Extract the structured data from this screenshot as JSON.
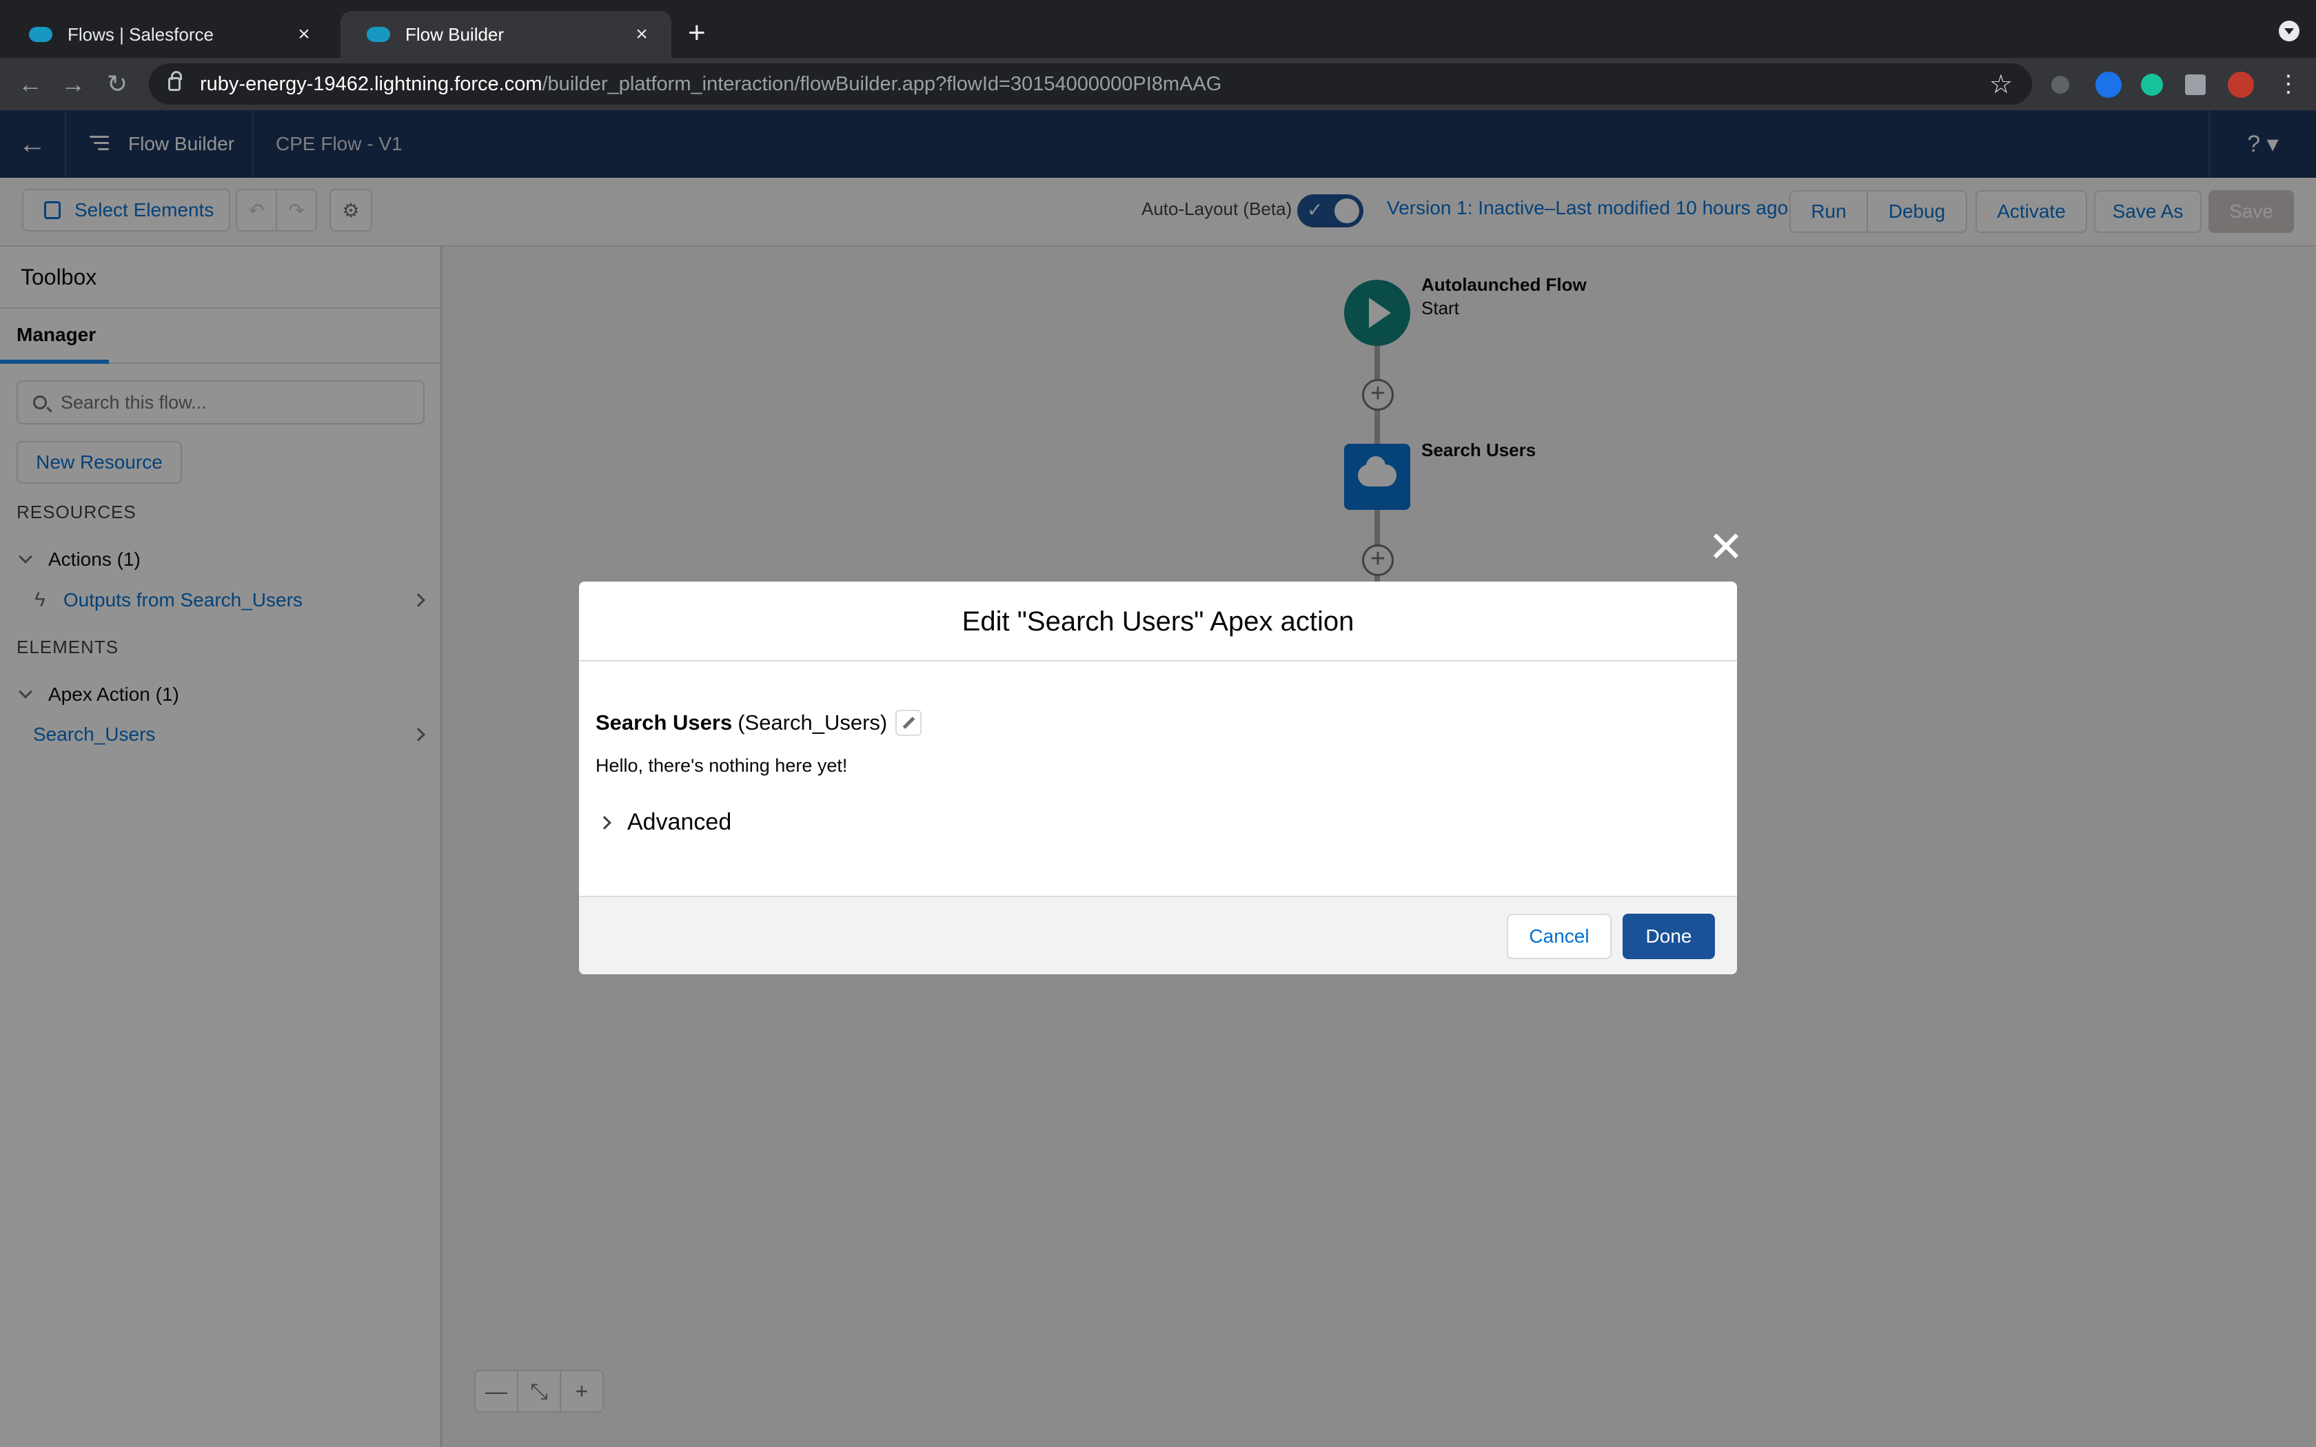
{
  "browser": {
    "tabs": [
      {
        "title": "Flows | Salesforce",
        "close": "×"
      },
      {
        "title": "Flow Builder",
        "close": "×"
      }
    ],
    "new_tab": "+",
    "url_host": "ruby-energy-19462.lightning.force.com",
    "url_path": "/builder_platform_interaction/flowBuilder.app?flowId=30154000000PI8mAAG",
    "nav": {
      "back": "←",
      "forward": "→",
      "reload": "↻"
    },
    "star": "☆",
    "extension_colors": [
      "#5f6368",
      "#1a73e8",
      "#15c39a",
      "#9aa0a6",
      "#c0392b"
    ]
  },
  "header": {
    "back": "←",
    "app_name": "Flow Builder",
    "flow_name": "CPE Flow - V1",
    "help": "? ▾"
  },
  "toolbar": {
    "select_elements": "Select Elements",
    "undo": "↶",
    "redo": "↷",
    "settings": "⚙",
    "auto_layout_label": "Auto-Layout (Beta)",
    "auto_layout_on": true,
    "version_status": "Version 1: Inactive–Last modified 10 hours ago",
    "run": "Run",
    "debug": "Debug",
    "activate": "Activate",
    "save_as": "Save As",
    "save": "Save"
  },
  "toolbox": {
    "title": "Toolbox",
    "tab": "Manager",
    "search_placeholder": "Search this flow...",
    "new_resource": "New Resource",
    "resources_label": "RESOURCES",
    "actions_group": "Actions (1)",
    "actions_item": "Outputs from Search_Users",
    "elements_label": "ELEMENTS",
    "apex_group": "Apex Action (1)",
    "apex_item": "Search_Users"
  },
  "canvas": {
    "start_title": "Autolaunched Flow",
    "start_sub": "Start",
    "action_label": "Search Users",
    "add_symbol": "+",
    "zoom_out": "—",
    "fit": "⤡",
    "zoom_in": "+"
  },
  "modal": {
    "close": "✕",
    "title": "Edit \"Search Users\" Apex action",
    "element_label": "Search Users",
    "api_name": "(Search_Users)",
    "message": "Hello, there's nothing here yet!",
    "advanced": "Advanced",
    "cancel": "Cancel",
    "done": "Done"
  },
  "colors": {
    "header_bg": "#16325c",
    "brand_button": "#1b5297",
    "link": "#0070d2",
    "start_node": "#0b827c",
    "action_node": "#0070d2"
  }
}
